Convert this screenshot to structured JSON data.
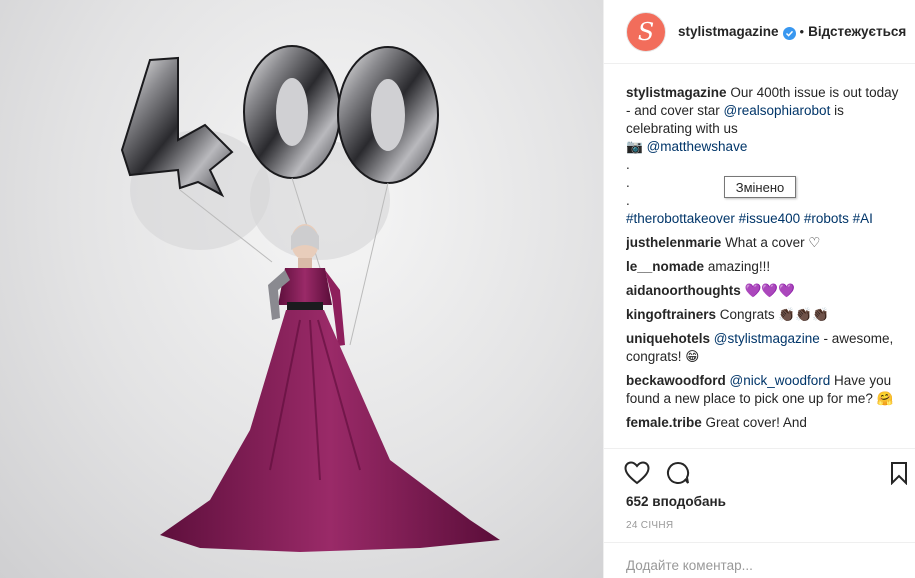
{
  "header": {
    "avatar_letter": "S",
    "username": "stylistmagazine",
    "separator": "•",
    "follow_label": "Відстежується"
  },
  "caption": {
    "username": "stylistmagazine",
    "text_1": "Our 400th issue is out today - and cover star ",
    "mention_1": "@realsophiarobot",
    "text_2": " is celebrating with us",
    "camera_emoji": "📷",
    "mention_2": "@matthewshave",
    "dot": ".",
    "hashtags": "#therobottakeover #issue400 #robots #AI"
  },
  "tooltip": "Змінено",
  "comments": [
    {
      "user": "justhelenmarie",
      "text": "What a cover ♡"
    },
    {
      "user": "le__nomade",
      "text": "amazing!!!"
    },
    {
      "user": "aidanoorthoughts",
      "text": "💜💜💜"
    },
    {
      "user": "kingoftrainers",
      "text": "Congrats 👏🏿👏🏿👏🏿"
    },
    {
      "user": "uniquehotels",
      "mention": "@stylistmagazine",
      "text": " - awesome, congrats! 😁"
    },
    {
      "user": "beckawoodford",
      "mention": "@nick_woodford",
      "text": " Have you found a new place to pick one up for me? 🤗"
    },
    {
      "user": "female.tribe",
      "text": "Great cover! And"
    }
  ],
  "likes": "652 вподобань",
  "date": "24 СІЧНЯ",
  "add_comment_placeholder": "Додайте коментар...",
  "photo_text": "400",
  "colors": {
    "avatar_bg": "#f26d5b",
    "verified": "#3897f0",
    "link": "#003569",
    "dress": "#8e1f5c"
  }
}
